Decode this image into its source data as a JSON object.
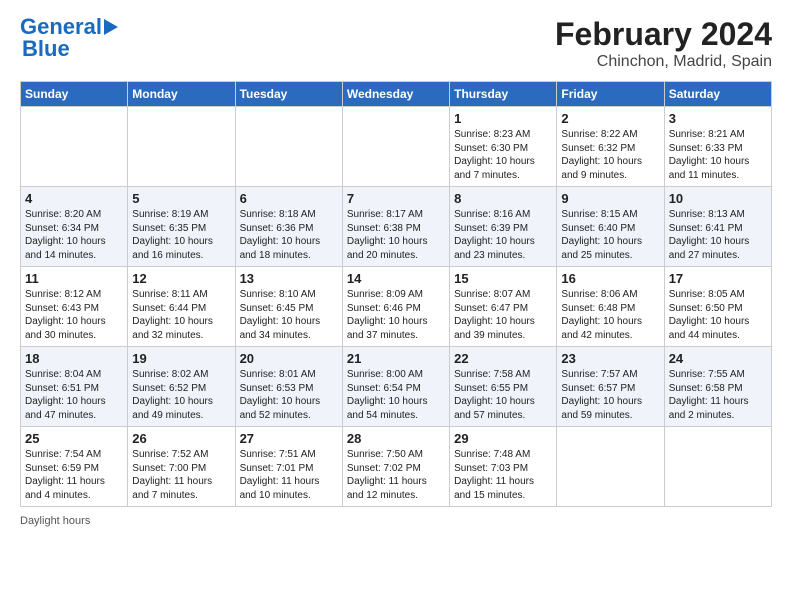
{
  "logo": {
    "line1": "General",
    "line2": "Blue"
  },
  "title": "February 2024",
  "subtitle": "Chinchon, Madrid, Spain",
  "days_header": [
    "Sunday",
    "Monday",
    "Tuesday",
    "Wednesday",
    "Thursday",
    "Friday",
    "Saturday"
  ],
  "weeks": [
    [
      {
        "day": "",
        "info": ""
      },
      {
        "day": "",
        "info": ""
      },
      {
        "day": "",
        "info": ""
      },
      {
        "day": "",
        "info": ""
      },
      {
        "day": "1",
        "info": "Sunrise: 8:23 AM\nSunset: 6:30 PM\nDaylight: 10 hours\nand 7 minutes."
      },
      {
        "day": "2",
        "info": "Sunrise: 8:22 AM\nSunset: 6:32 PM\nDaylight: 10 hours\nand 9 minutes."
      },
      {
        "day": "3",
        "info": "Sunrise: 8:21 AM\nSunset: 6:33 PM\nDaylight: 10 hours\nand 11 minutes."
      }
    ],
    [
      {
        "day": "4",
        "info": "Sunrise: 8:20 AM\nSunset: 6:34 PM\nDaylight: 10 hours\nand 14 minutes."
      },
      {
        "day": "5",
        "info": "Sunrise: 8:19 AM\nSunset: 6:35 PM\nDaylight: 10 hours\nand 16 minutes."
      },
      {
        "day": "6",
        "info": "Sunrise: 8:18 AM\nSunset: 6:36 PM\nDaylight: 10 hours\nand 18 minutes."
      },
      {
        "day": "7",
        "info": "Sunrise: 8:17 AM\nSunset: 6:38 PM\nDaylight: 10 hours\nand 20 minutes."
      },
      {
        "day": "8",
        "info": "Sunrise: 8:16 AM\nSunset: 6:39 PM\nDaylight: 10 hours\nand 23 minutes."
      },
      {
        "day": "9",
        "info": "Sunrise: 8:15 AM\nSunset: 6:40 PM\nDaylight: 10 hours\nand 25 minutes."
      },
      {
        "day": "10",
        "info": "Sunrise: 8:13 AM\nSunset: 6:41 PM\nDaylight: 10 hours\nand 27 minutes."
      }
    ],
    [
      {
        "day": "11",
        "info": "Sunrise: 8:12 AM\nSunset: 6:43 PM\nDaylight: 10 hours\nand 30 minutes."
      },
      {
        "day": "12",
        "info": "Sunrise: 8:11 AM\nSunset: 6:44 PM\nDaylight: 10 hours\nand 32 minutes."
      },
      {
        "day": "13",
        "info": "Sunrise: 8:10 AM\nSunset: 6:45 PM\nDaylight: 10 hours\nand 34 minutes."
      },
      {
        "day": "14",
        "info": "Sunrise: 8:09 AM\nSunset: 6:46 PM\nDaylight: 10 hours\nand 37 minutes."
      },
      {
        "day": "15",
        "info": "Sunrise: 8:07 AM\nSunset: 6:47 PM\nDaylight: 10 hours\nand 39 minutes."
      },
      {
        "day": "16",
        "info": "Sunrise: 8:06 AM\nSunset: 6:48 PM\nDaylight: 10 hours\nand 42 minutes."
      },
      {
        "day": "17",
        "info": "Sunrise: 8:05 AM\nSunset: 6:50 PM\nDaylight: 10 hours\nand 44 minutes."
      }
    ],
    [
      {
        "day": "18",
        "info": "Sunrise: 8:04 AM\nSunset: 6:51 PM\nDaylight: 10 hours\nand 47 minutes."
      },
      {
        "day": "19",
        "info": "Sunrise: 8:02 AM\nSunset: 6:52 PM\nDaylight: 10 hours\nand 49 minutes."
      },
      {
        "day": "20",
        "info": "Sunrise: 8:01 AM\nSunset: 6:53 PM\nDaylight: 10 hours\nand 52 minutes."
      },
      {
        "day": "21",
        "info": "Sunrise: 8:00 AM\nSunset: 6:54 PM\nDaylight: 10 hours\nand 54 minutes."
      },
      {
        "day": "22",
        "info": "Sunrise: 7:58 AM\nSunset: 6:55 PM\nDaylight: 10 hours\nand 57 minutes."
      },
      {
        "day": "23",
        "info": "Sunrise: 7:57 AM\nSunset: 6:57 PM\nDaylight: 10 hours\nand 59 minutes."
      },
      {
        "day": "24",
        "info": "Sunrise: 7:55 AM\nSunset: 6:58 PM\nDaylight: 11 hours\nand 2 minutes."
      }
    ],
    [
      {
        "day": "25",
        "info": "Sunrise: 7:54 AM\nSunset: 6:59 PM\nDaylight: 11 hours\nand 4 minutes."
      },
      {
        "day": "26",
        "info": "Sunrise: 7:52 AM\nSunset: 7:00 PM\nDaylight: 11 hours\nand 7 minutes."
      },
      {
        "day": "27",
        "info": "Sunrise: 7:51 AM\nSunset: 7:01 PM\nDaylight: 11 hours\nand 10 minutes."
      },
      {
        "day": "28",
        "info": "Sunrise: 7:50 AM\nSunset: 7:02 PM\nDaylight: 11 hours\nand 12 minutes."
      },
      {
        "day": "29",
        "info": "Sunrise: 7:48 AM\nSunset: 7:03 PM\nDaylight: 11 hours\nand 15 minutes."
      },
      {
        "day": "",
        "info": ""
      },
      {
        "day": "",
        "info": ""
      }
    ]
  ],
  "footer": "Daylight hours"
}
